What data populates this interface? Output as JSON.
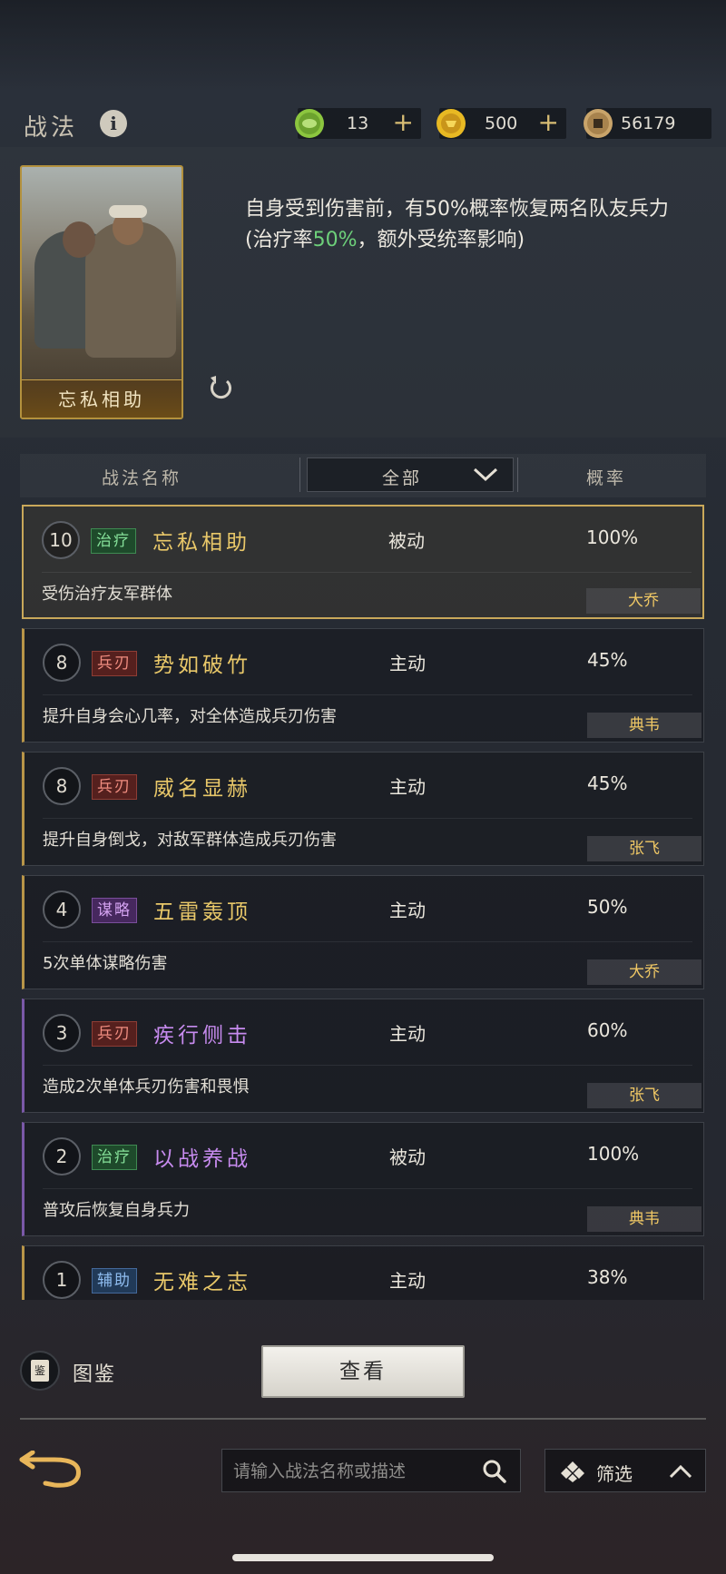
{
  "header": {
    "title": "战法",
    "currencies": [
      {
        "icon": "jade-coin-icon",
        "value": "13"
      },
      {
        "icon": "gold-coin-icon",
        "value": "500"
      },
      {
        "icon": "copper-coin-icon",
        "value": "56179"
      }
    ]
  },
  "selected": {
    "card_name": "忘私相助",
    "desc_part1": "自身受到伤害前，有50%概率恢复两名队友兵力(治疗率",
    "desc_highlight": "50%",
    "desc_part2": "，额外受统率影响)"
  },
  "list_header": {
    "name_col": "战法名称",
    "filter_value": "全部",
    "rate_col": "概率"
  },
  "skills": [
    {
      "level": "10",
      "tag": "治疗",
      "name": "忘私相助",
      "type": "被动",
      "rate": "100%",
      "desc": "受伤治疗友军群体",
      "owner": "大乔"
    },
    {
      "level": "8",
      "tag": "兵刃",
      "name": "势如破竹",
      "type": "主动",
      "rate": "45%",
      "desc": "提升自身会心几率，对全体造成兵刃伤害",
      "owner": "典韦"
    },
    {
      "level": "8",
      "tag": "兵刃",
      "name": "威名显赫",
      "type": "主动",
      "rate": "45%",
      "desc": "提升自身倒戈，对敌军群体造成兵刃伤害",
      "owner": "张飞"
    },
    {
      "level": "4",
      "tag": "谋略",
      "name": "五雷轰顶",
      "type": "主动",
      "rate": "50%",
      "desc": "5次单体谋略伤害",
      "owner": "大乔"
    },
    {
      "level": "3",
      "tag": "兵刃",
      "name": "疾行侧击",
      "type": "主动",
      "rate": "60%",
      "desc": "造成2次单体兵刃伤害和畏惧",
      "owner": "张飞"
    },
    {
      "level": "2",
      "tag": "治疗",
      "name": "以战养战",
      "type": "被动",
      "rate": "100%",
      "desc": "普攻后恢复自身兵力",
      "owner": "典韦"
    },
    {
      "level": "1",
      "tag": "辅助",
      "name": "无难之志",
      "type": "主动",
      "rate": "38%"
    }
  ],
  "bottom": {
    "book_label": "图鉴",
    "view_button": "查看",
    "search_placeholder": "请输入战法名称或描述",
    "filter_label": "筛选"
  },
  "colors": {
    "gold_name": "#e9c869",
    "purple_name": "#c78bef",
    "heal_green": "#6dd07a",
    "owner_gold": "#f0c865"
  }
}
